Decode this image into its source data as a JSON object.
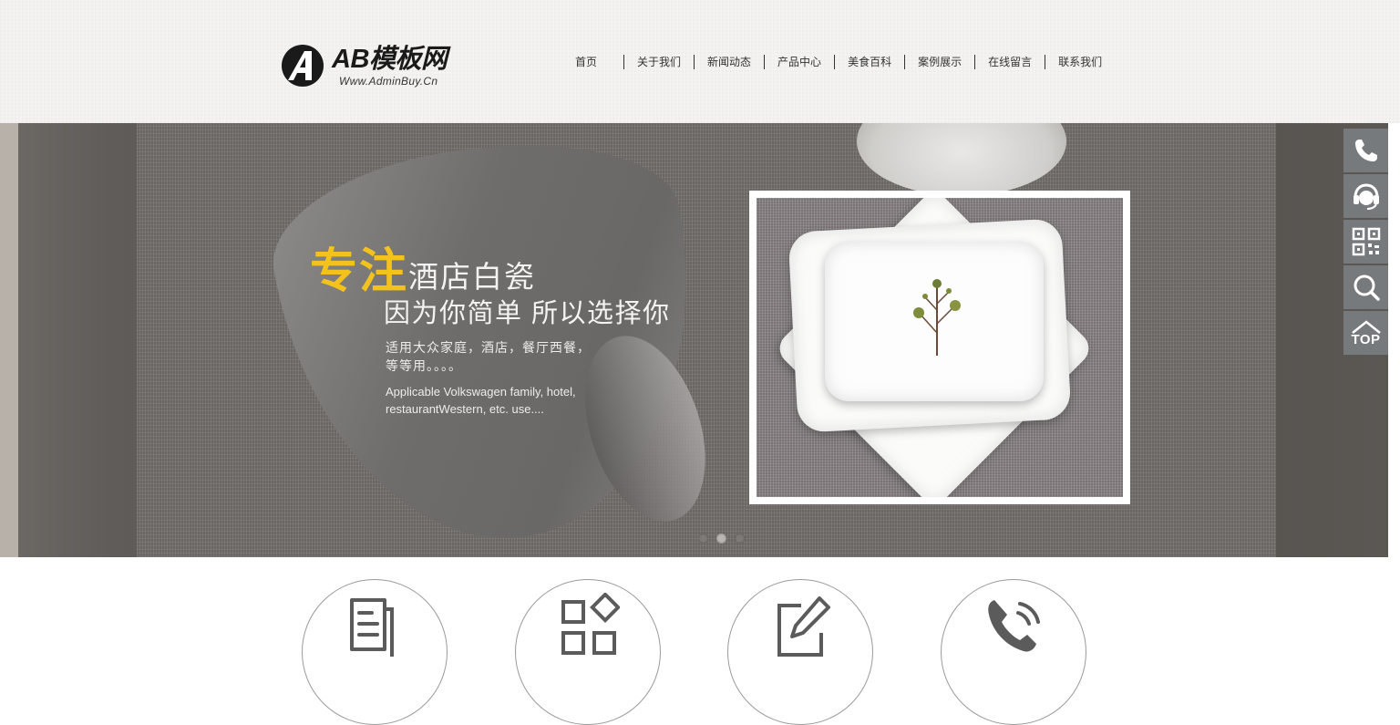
{
  "header": {
    "logo": {
      "title": "AB模板网",
      "subtitle": "Www.AdminBuy.Cn"
    },
    "nav": [
      {
        "label": "首页"
      },
      {
        "label": "关于我们"
      },
      {
        "label": "新闻动态"
      },
      {
        "label": "产品中心"
      },
      {
        "label": "美食百科"
      },
      {
        "label": "案例展示"
      },
      {
        "label": "在线留言"
      },
      {
        "label": "联系我们"
      }
    ]
  },
  "banner": {
    "headline_highlight": "专注",
    "headline_rest": "酒店白瓷",
    "tagline": "因为你简单 所以选择你",
    "desc_cn": "适用大众家庭，酒店，餐厅西餐，等等用。。。。",
    "desc_en": "Applicable Volkswagen family, hotel, restaurantWestern, etc. use....",
    "active_slide": 2,
    "slide_count": 3
  },
  "sidebar": {
    "buttons": [
      {
        "icon": "phone-icon"
      },
      {
        "icon": "customer-service-icon"
      },
      {
        "icon": "qr-code-icon"
      },
      {
        "icon": "search-icon"
      },
      {
        "icon": "back-to-top-icon",
        "label": "TOP"
      }
    ]
  },
  "services": [
    {
      "icon": "document-icon"
    },
    {
      "icon": "apps-grid-icon"
    },
    {
      "icon": "edit-icon"
    },
    {
      "icon": "phone-call-icon"
    }
  ],
  "colors": {
    "highlight": "#f4c21c",
    "sidebar_bg": "#777a7d",
    "text_dark": "#333333"
  }
}
